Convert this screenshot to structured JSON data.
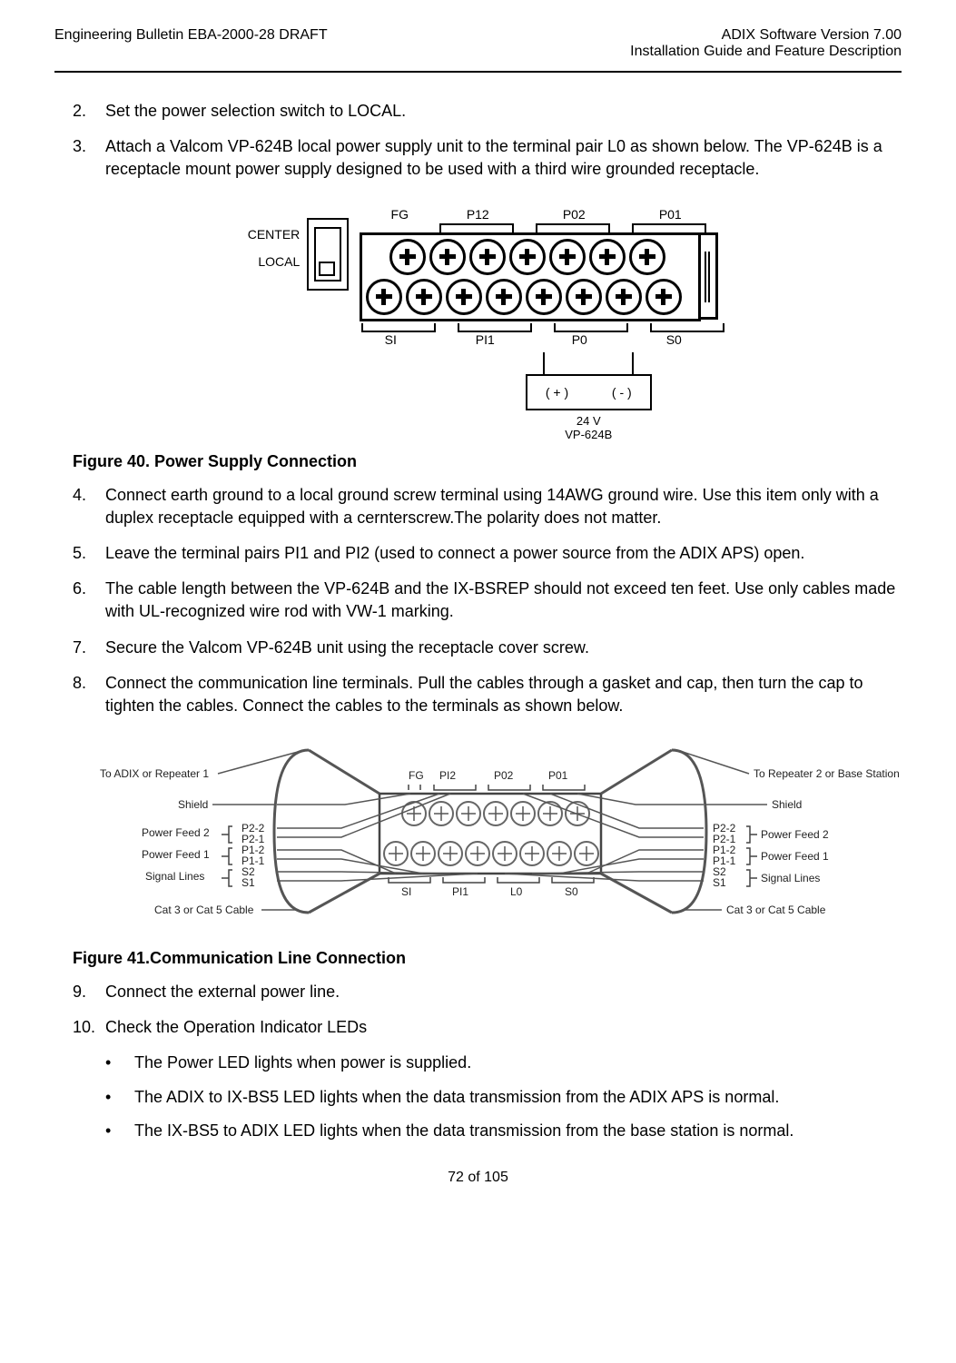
{
  "header": {
    "left": "Engineering Bulletin EBA-2000-28 DRAFT",
    "right_line1": "ADIX Software Version 7.00",
    "right_line2": "Installation Guide and Feature Description"
  },
  "steps": {
    "s2": {
      "num": "2.",
      "text": "Set the power selection switch  to LOCAL."
    },
    "s3": {
      "num": "3.",
      "text": "Attach a Valcom VP-624B local power supply unit  to the terminal pair L0 as shown below. The VP-624B is a receptacle mount power supply designed to be used with a third wire grounded receptacle."
    },
    "s4": {
      "num": "4.",
      "text": "Connect earth ground to a local ground screw terminal using 14AWG ground wire.  Use this item only with a duplex receptacle equipped with a cernterscrew.The polarity does not matter."
    },
    "s5": {
      "num": "5.",
      "text": "Leave the terminal pairs PI1 and PI2 (used to connect a power source from the ADIX APS) open."
    },
    "s6": {
      "num": "6.",
      "text": "The cable length between the VP-624B and the IX-BSREP should not exceed ten feet.  Use only cables made with UL-recognized wire rod with VW-1 marking."
    },
    "s7": {
      "num": "7.",
      "text": "Secure the Valcom VP-624B unit using the receptacle cover screw."
    },
    "s8": {
      "num": "8.",
      "text": "Connect the communication line terminals. Pull the cables through a gasket and cap, then turn the cap to tighten the cables. Connect the cables to the terminals as shown below."
    },
    "s9": {
      "num": "9.",
      "text": "Connect the external power line."
    },
    "s10": {
      "num": "10.",
      "text": "Check the Operation Indicator LEDs"
    }
  },
  "bullets": {
    "b1": "The Power LED lights when power is supplied.",
    "b2": "The ADIX to IX-BS5 LED lights when the data transmission from the ADIX APS is normal.",
    "b3": "The IX-BS5 to ADIX LED lights when the data transmission from the base station is normal."
  },
  "figures": {
    "f40": {
      "caption": "Figure 40.  Power Supply Connection",
      "switch_label_top": "CENTER",
      "switch_label_bottom": "LOCAL",
      "top_labels": {
        "fg": "FG",
        "p12": "P12",
        "p02": "P02",
        "p01": "P01"
      },
      "bottom_labels": {
        "si": "SI",
        "pi1": "PI1",
        "p0": "P0",
        "s0": "S0"
      },
      "drop": {
        "plus": "( + )",
        "minus": "( - )",
        "volt": "24 V",
        "model": "VP-624B"
      }
    },
    "f41": {
      "caption": "Figure 41.Communication Line Connection",
      "left_title": "To ADIX or Repeater 1",
      "right_title": "To Repeater 2 or Base Station",
      "left_labels": {
        "shield": "Shield",
        "pf2": "Power Feed 2",
        "pf1": "Power Feed 1",
        "sig": "Signal Lines"
      },
      "right_labels": {
        "shield": "Shield",
        "pf2": "Power Feed 2",
        "pf1": "Power Feed 1",
        "sig": "Signal Lines"
      },
      "pins_left": [
        "P2-2",
        "P2-1",
        "P1-2",
        "P1-1",
        "S2",
        "S1"
      ],
      "pins_right": [
        "P2-2",
        "P2-1",
        "P1-2",
        "P1-1",
        "S2",
        "S1"
      ],
      "top_labels": {
        "fg": "FG",
        "pi2": "PI2",
        "p02": "P02",
        "p01": "P01"
      },
      "bottom_labels": {
        "si": "SI",
        "pi1": "PI1",
        "l0": "L0",
        "s0": "S0"
      },
      "cable_note": "Cat 3 or Cat 5 Cable"
    }
  },
  "page_number": "72 of 105"
}
